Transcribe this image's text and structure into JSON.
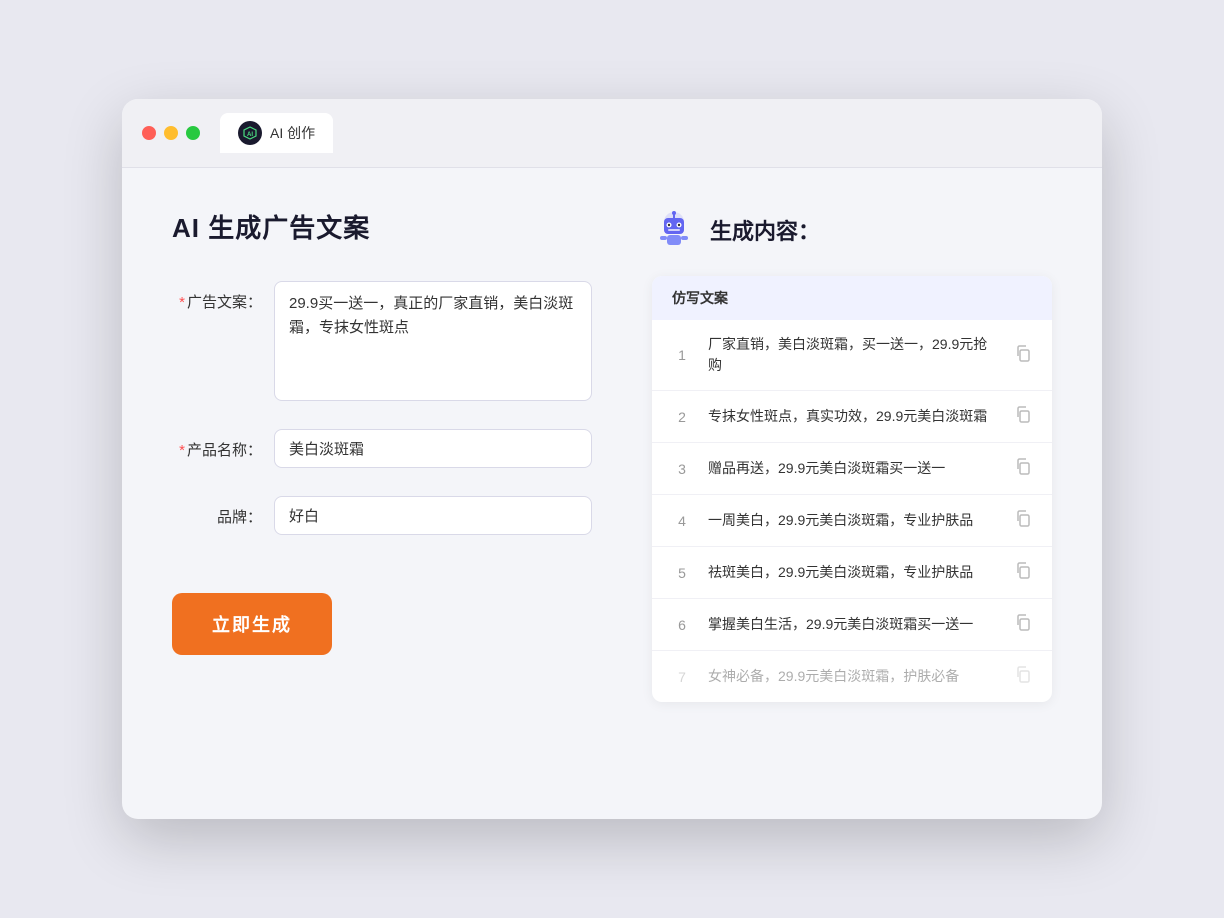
{
  "browser": {
    "tab_label": "AI 创作",
    "traffic_lights": [
      "red",
      "yellow",
      "green"
    ]
  },
  "left_panel": {
    "title": "AI 生成广告文案",
    "form": {
      "ad_copy_label": "广告文案：",
      "ad_copy_required": true,
      "ad_copy_value": "29.9买一送一，真正的厂家直销，美白淡斑霜，专抹女性斑点",
      "product_name_label": "产品名称：",
      "product_name_required": true,
      "product_name_value": "美白淡斑霜",
      "brand_label": "品牌：",
      "brand_required": false,
      "brand_value": "好白"
    },
    "generate_button_label": "立即生成"
  },
  "right_panel": {
    "title": "生成内容：",
    "table_header": "仿写文案",
    "results": [
      {
        "num": 1,
        "text": "厂家直销，美白淡斑霜，买一送一，29.9元抢购"
      },
      {
        "num": 2,
        "text": "专抹女性斑点，真实功效，29.9元美白淡斑霜"
      },
      {
        "num": 3,
        "text": "赠品再送，29.9元美白淡斑霜买一送一"
      },
      {
        "num": 4,
        "text": "一周美白，29.9元美白淡斑霜，专业护肤品"
      },
      {
        "num": 5,
        "text": "祛斑美白，29.9元美白淡斑霜，专业护肤品"
      },
      {
        "num": 6,
        "text": "掌握美白生活，29.9元美白淡斑霜买一送一"
      },
      {
        "num": 7,
        "text": "女神必备，29.9元美白淡斑霜，护肤必备",
        "dimmed": true
      }
    ]
  }
}
